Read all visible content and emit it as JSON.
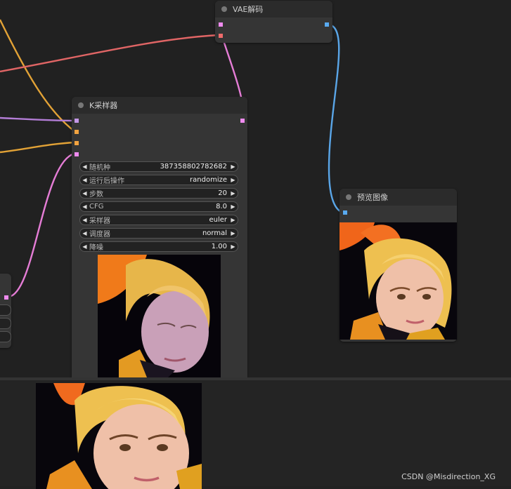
{
  "nodes": {
    "vae_decode": {
      "title": "VAE解码"
    },
    "ksampler": {
      "title": "K采样器",
      "widgets": [
        {
          "name": "随机种",
          "value": "387358802782682"
        },
        {
          "name": "运行后操作",
          "value": "randomize"
        },
        {
          "name": "步数",
          "value": "20"
        },
        {
          "name": "CFG",
          "value": "8.0"
        },
        {
          "name": "采样器",
          "value": "euler"
        },
        {
          "name": "调度器",
          "value": "normal"
        },
        {
          "name": "降噪",
          "value": "1.00"
        }
      ]
    },
    "preview": {
      "title": "预览图像"
    }
  },
  "icons": {
    "decrement": "arrow-left-icon",
    "increment": "arrow-right-icon",
    "status": "node-status-dot-icon"
  },
  "colors": {
    "wire_model": "#b37dd6",
    "wire_conditioning": "#e2a236",
    "wire_vae": "#e06565",
    "wire_latent": "#e57dd6",
    "wire_image": "#5aa6e8",
    "slot_pink": "#ef8bef",
    "slot_orange": "#f2a340",
    "slot_red": "#ef6b6b",
    "slot_blue": "#59aaf0"
  },
  "footer": {
    "credit": "CSDN @Misdirection_XG"
  }
}
